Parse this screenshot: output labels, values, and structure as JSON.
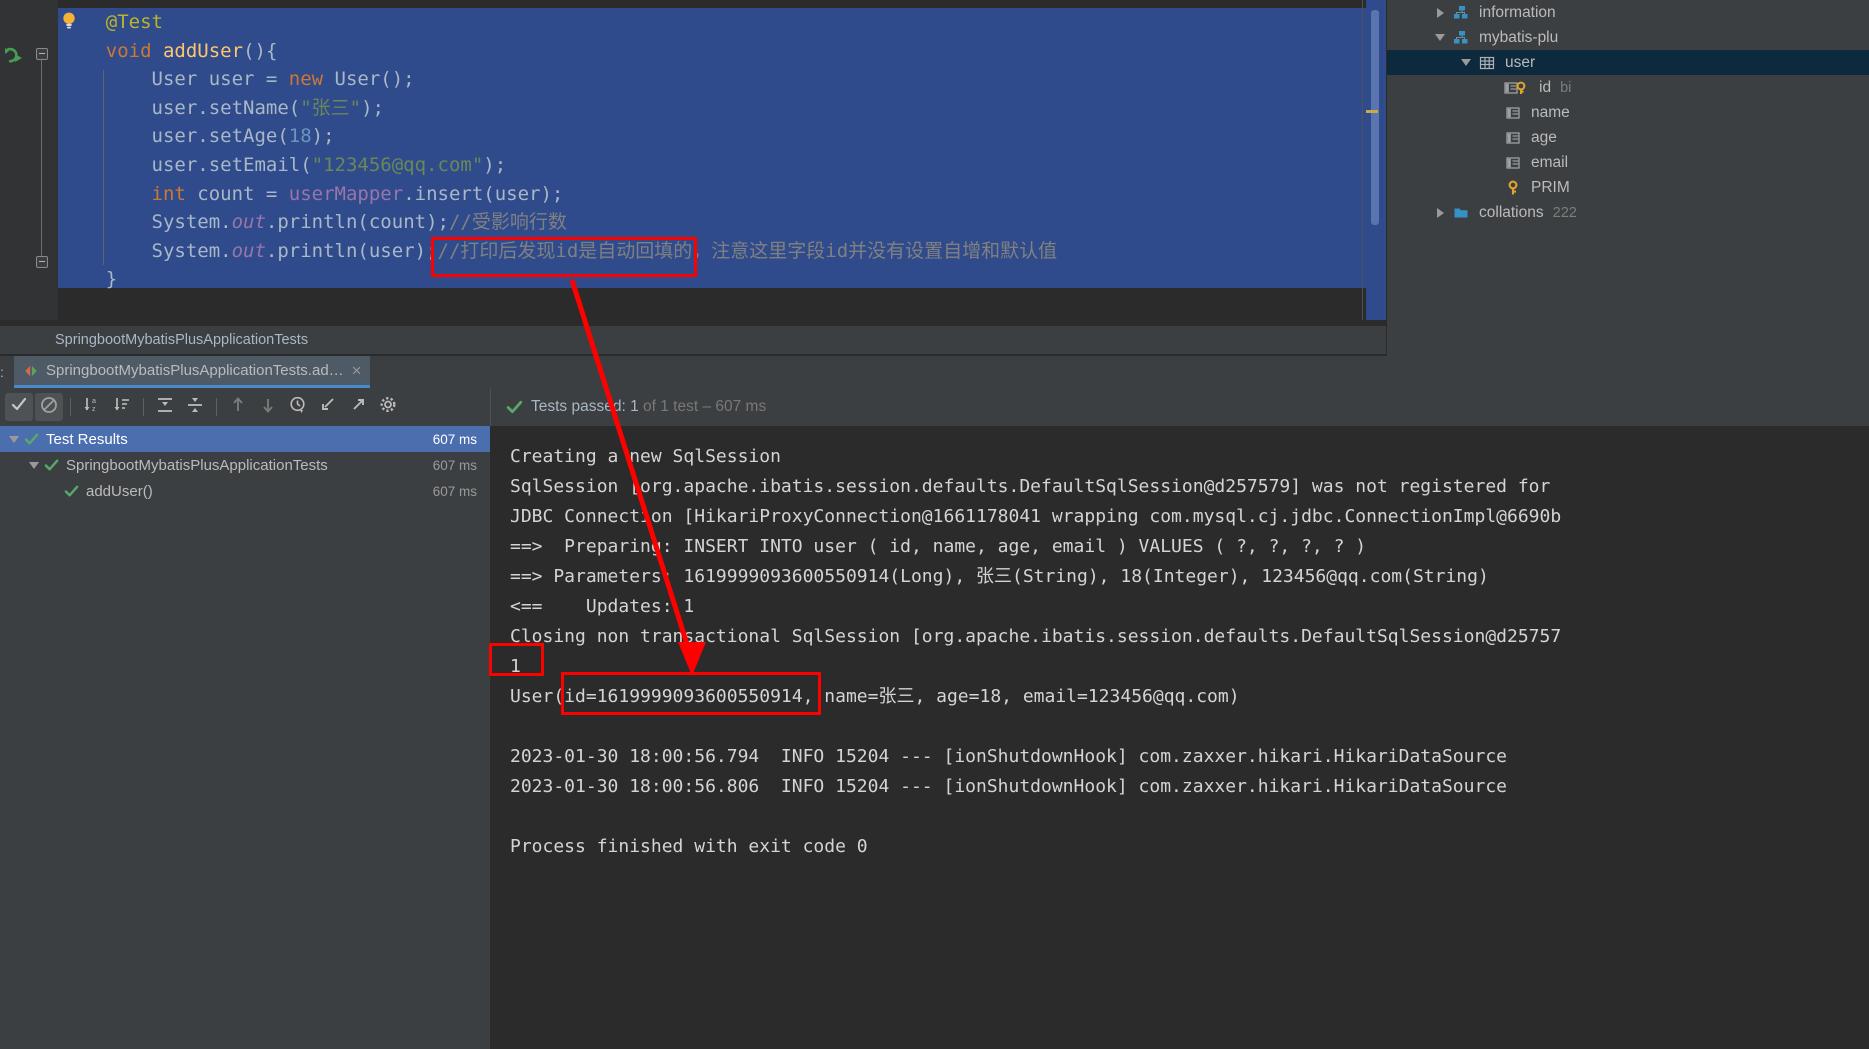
{
  "editor": {
    "code_lines": [
      [
        {
          "t": "    ",
          "c": "plain"
        },
        {
          "t": "@Test",
          "c": "annot"
        }
      ],
      [
        {
          "t": "    ",
          "c": "plain"
        },
        {
          "t": "void",
          "c": "kw"
        },
        {
          "t": " ",
          "c": "plain"
        },
        {
          "t": "addUser",
          "c": "mth"
        },
        {
          "t": "(){",
          "c": "plain"
        }
      ],
      [
        {
          "t": "        User user = ",
          "c": "plain"
        },
        {
          "t": "new",
          "c": "kw"
        },
        {
          "t": " User();",
          "c": "plain"
        }
      ],
      [
        {
          "t": "        user.setName(",
          "c": "plain"
        },
        {
          "t": "\"张三\"",
          "c": "str"
        },
        {
          "t": ");",
          "c": "plain"
        }
      ],
      [
        {
          "t": "        user.setAge(",
          "c": "plain"
        },
        {
          "t": "18",
          "c": "num"
        },
        {
          "t": ");",
          "c": "plain"
        }
      ],
      [
        {
          "t": "        user.setEmail(",
          "c": "plain"
        },
        {
          "t": "\"123456@qq.com\"",
          "c": "str"
        },
        {
          "t": ");",
          "c": "plain"
        }
      ],
      [
        {
          "t": "        ",
          "c": "plain"
        },
        {
          "t": "int",
          "c": "kw"
        },
        {
          "t": " count = ",
          "c": "plain"
        },
        {
          "t": "userMapper",
          "c": "fld"
        },
        {
          "t": ".insert(user);",
          "c": "plain"
        }
      ],
      [
        {
          "t": "        System.",
          "c": "plain"
        },
        {
          "t": "out",
          "c": "ital"
        },
        {
          "t": ".println(count);",
          "c": "plain"
        },
        {
          "t": "//受影响行数",
          "c": "cmt"
        }
      ],
      [
        {
          "t": "        System.",
          "c": "plain"
        },
        {
          "t": "out",
          "c": "ital"
        },
        {
          "t": ".println(user);",
          "c": "plain"
        },
        {
          "t": "//打印后发现id是自动回填的，注意这里字段id并没有设置自增和默认值",
          "c": "cmt"
        }
      ],
      [
        {
          "t": "    }",
          "c": "plain"
        }
      ]
    ],
    "breadcrumb": "SpringbootMybatisPlusApplicationTests",
    "accent_selection_color": "#2f4b8c"
  },
  "run_tool_window": {
    "left_rail_label": ":",
    "tab_label": "SpringbootMybatisPlusApplicationTests.ad…",
    "tab_close": "×",
    "toolbar_buttons": [
      {
        "name": "show-passed-tests",
        "icon": "check-icon",
        "label": "Show Passed",
        "active": true
      },
      {
        "name": "show-ignored-tests",
        "icon": "ignore-icon",
        "label": "Show Ignored",
        "active": true
      },
      {
        "name": "sort-alphabetically",
        "icon": "sort-alpha-icon",
        "label": "Sort Alphabetically",
        "active": false
      },
      {
        "name": "sort-by-duration",
        "icon": "sort-duration-icon",
        "label": "Sort by Duration",
        "active": false
      },
      {
        "name": "expand-all",
        "icon": "expand-all-icon",
        "label": "Expand All",
        "active": false
      },
      {
        "name": "collapse-all",
        "icon": "collapse-all-icon",
        "label": "Collapse All",
        "active": false
      },
      {
        "name": "prev-test",
        "icon": "arrow-up-icon",
        "label": "Previous Failed Test",
        "active": false
      },
      {
        "name": "next-test",
        "icon": "arrow-down-icon",
        "label": "Next Failed Test",
        "active": false
      },
      {
        "name": "test-history",
        "icon": "clock-history-icon",
        "label": "Test History",
        "active": false
      },
      {
        "name": "import-results",
        "icon": "import-icon",
        "label": "Import Test Results",
        "active": false
      },
      {
        "name": "export-results",
        "icon": "export-icon",
        "label": "Export Test Results",
        "active": false
      },
      {
        "name": "settings",
        "icon": "gear-icon",
        "label": "Settings",
        "active": false
      }
    ],
    "status": {
      "prefix": "Tests passed: ",
      "count": "1",
      "middle": " of 1 test – ",
      "duration": "607 ms"
    },
    "tree": [
      {
        "label": "Test Results",
        "time": "607 ms",
        "depth": 0,
        "expanded": true,
        "selected": true,
        "status": "passed"
      },
      {
        "label": "SpringbootMybatisPlusApplicationTests",
        "time": "607 ms",
        "depth": 1,
        "expanded": true,
        "selected": false,
        "status": "passed"
      },
      {
        "label": "addUser()",
        "time": "607 ms",
        "depth": 2,
        "expanded": null,
        "selected": false,
        "status": "passed"
      }
    ],
    "console_lines": [
      "Creating a new SqlSession",
      "SqlSession [org.apache.ibatis.session.defaults.DefaultSqlSession@d257579] was not registered for",
      "JDBC Connection [HikariProxyConnection@1661178041 wrapping com.mysql.cj.jdbc.ConnectionImpl@6690b",
      "==>  Preparing: INSERT INTO user ( id, name, age, email ) VALUES ( ?, ?, ?, ? )",
      "==> Parameters: 1619999093600550914(Long), 张三(String), 18(Integer), 123456@qq.com(String)",
      "<==    Updates: 1",
      "Closing non transactional SqlSession [org.apache.ibatis.session.defaults.DefaultSqlSession@d25757",
      "1",
      "User(id=1619999093600550914, name=张三, age=18, email=123456@qq.com)",
      "",
      "2023-01-30 18:00:56.794  INFO 15204 --- [ionShutdownHook] com.zaxxer.hikari.HikariDataSource",
      "2023-01-30 18:00:56.806  INFO 15204 --- [ionShutdownHook] com.zaxxer.hikari.HikariDataSource",
      "",
      "Process finished with exit code 0"
    ]
  },
  "database_panel": {
    "rows": [
      {
        "label": "information",
        "type": "",
        "depth": 1,
        "expanded": false,
        "icon": "schema-icon",
        "selected": false
      },
      {
        "label": "mybatis-plu",
        "type": "",
        "depth": 1,
        "expanded": true,
        "icon": "schema-icon",
        "selected": false
      },
      {
        "label": "user",
        "type": "",
        "depth": 2,
        "expanded": true,
        "icon": "table-icon",
        "selected": true
      },
      {
        "label": "id",
        "type": "bi",
        "depth": 3,
        "expanded": null,
        "icon": "column-pk-icon",
        "selected": false
      },
      {
        "label": "name",
        "type": "",
        "depth": 3,
        "expanded": null,
        "icon": "column-icon",
        "selected": false
      },
      {
        "label": "age",
        "type": "",
        "depth": 3,
        "expanded": null,
        "icon": "column-icon",
        "selected": false
      },
      {
        "label": "email",
        "type": "",
        "depth": 3,
        "expanded": null,
        "icon": "column-icon",
        "selected": false
      },
      {
        "label": "PRIM",
        "type": "",
        "depth": 3,
        "expanded": null,
        "icon": "key-icon",
        "selected": false
      },
      {
        "label": "collations",
        "type": "222",
        "depth": 1,
        "expanded": false,
        "icon": "folder-icon",
        "selected": false
      }
    ]
  },
  "annotations": {
    "box_color": "#ff0000",
    "comment_box_text": "打印后发现id是自动回填的，",
    "count_box_text": "1",
    "id_box_text": "id=1619999093600550914,"
  }
}
